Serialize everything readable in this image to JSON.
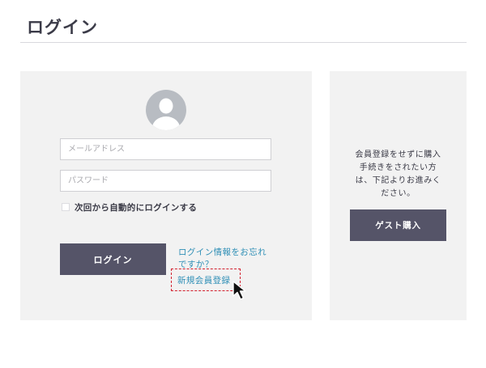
{
  "header": {
    "title": "ログイン"
  },
  "login": {
    "avatar_icon": "user-avatar-icon",
    "email_placeholder": "メールアドレス",
    "password_placeholder": "パスワード",
    "remember_label": "次回から自動的にログインする",
    "remember_checked": false,
    "login_button_label": "ログイン",
    "forgot_link": "ログイン情報をお忘れですか？",
    "register_link": "新規会員登録"
  },
  "guest": {
    "description_lines": [
      "会員登録をせずに購入",
      "手続きをされたい方",
      "は、下記よりお進みく",
      "ださい。"
    ],
    "button_label": "ゲスト購入"
  },
  "colors": {
    "panel_bg": "#f2f2f2",
    "button_bg": "#555468",
    "link": "#2f8fb6",
    "highlight": "#d2202e",
    "avatar": "#b8bcc2"
  }
}
